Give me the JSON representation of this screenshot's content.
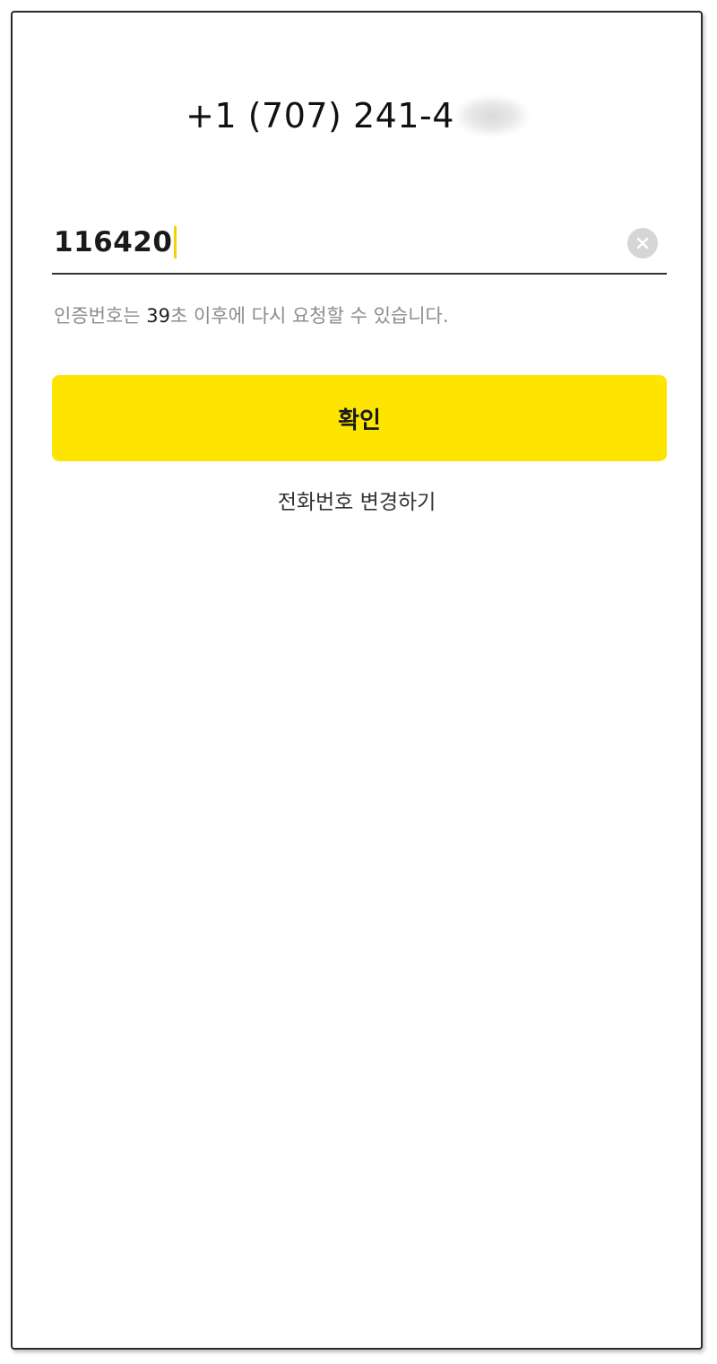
{
  "phone": {
    "number_visible": "+1 (707) 241-4",
    "masked_icon": "blurred-digits-mask"
  },
  "code_input": {
    "value": "116420",
    "clear_icon": "clear-circle-x-icon"
  },
  "helper": {
    "prefix": "인증번호는 ",
    "seconds": "39",
    "suffix": "초 이후에 다시 요청할 수 있습니다."
  },
  "actions": {
    "confirm_label": "확인",
    "change_phone_label": "전화번호 변경하기"
  },
  "colors": {
    "accent": "#fee500",
    "caret": "#f5d200"
  }
}
